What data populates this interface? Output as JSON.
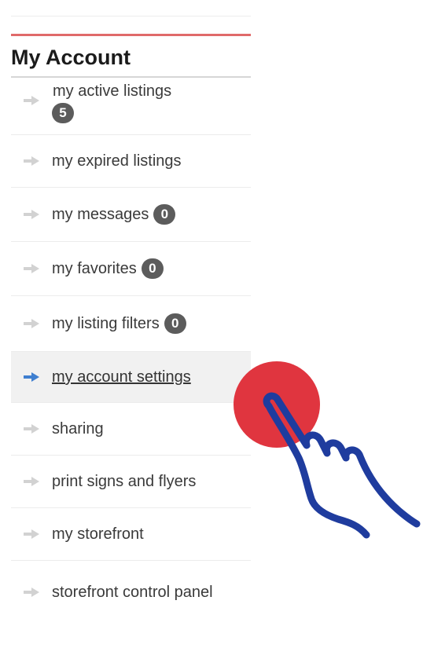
{
  "account": {
    "title": "My Account",
    "items": [
      {
        "label": "my active listings",
        "badge": "5",
        "icon": "arrow-right-icon"
      },
      {
        "label": "my expired listings",
        "icon": "arrow-right-icon"
      },
      {
        "label": "my messages",
        "badge": "0",
        "icon": "arrow-right-icon"
      },
      {
        "label": "my favorites",
        "badge": "0",
        "icon": "arrow-right-icon"
      },
      {
        "label": "my listing filters",
        "badge": "0",
        "icon": "arrow-right-icon"
      },
      {
        "label": "my account settings",
        "active": true,
        "icon": "arrow-right-icon"
      },
      {
        "label": "sharing",
        "icon": "arrow-right-icon"
      },
      {
        "label": "print signs and flyers",
        "icon": "arrow-right-icon"
      },
      {
        "label": "my storefront",
        "icon": "arrow-right-icon"
      },
      {
        "label": "storefront control panel",
        "icon": "arrow-right-icon"
      }
    ]
  },
  "colors": {
    "accent_rule": "#e06a6a",
    "badge_bg": "#5c5c5c",
    "arrow_inactive": "#d2d2d2",
    "arrow_active": "#3f7fd0",
    "click_marker": "#e0353f",
    "hand_outline": "#1f3c9e"
  },
  "overlay": {
    "icon": "tap-hand-icon"
  }
}
